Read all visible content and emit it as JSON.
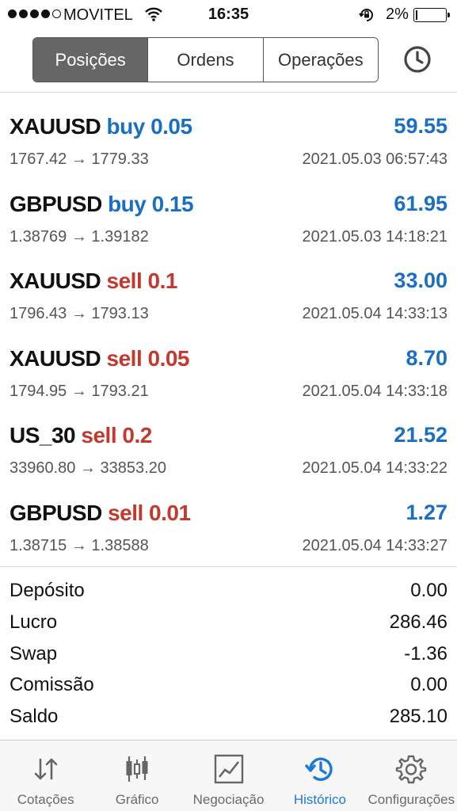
{
  "status_bar": {
    "carrier": "MOVITEL",
    "time": "16:35",
    "battery": "2%"
  },
  "segments": [
    {
      "label": "Posições",
      "active": true
    },
    {
      "label": "Ordens",
      "active": false
    },
    {
      "label": "Operações",
      "active": false
    }
  ],
  "deals": [
    {
      "symbol": "XAUUSD",
      "side": "buy 0.05",
      "direction": "buy",
      "profit": "59.55",
      "prices": "1767.42 → 1779.33",
      "time": "2021.05.03 06:57:43"
    },
    {
      "symbol": "GBPUSD",
      "side": "buy 0.15",
      "direction": "buy",
      "profit": "61.95",
      "prices": "1.38769 → 1.39182",
      "time": "2021.05.03 14:18:21"
    },
    {
      "symbol": "XAUUSD",
      "side": "sell 0.1",
      "direction": "sell",
      "profit": "33.00",
      "prices": "1796.43 → 1793.13",
      "time": "2021.05.04 14:33:13"
    },
    {
      "symbol": "XAUUSD",
      "side": "sell 0.05",
      "direction": "sell",
      "profit": "8.70",
      "prices": "1794.95 → 1793.21",
      "time": "2021.05.04 14:33:18"
    },
    {
      "symbol": "US_30",
      "side": "sell 0.2",
      "direction": "sell",
      "profit": "21.52",
      "prices": "33960.80 → 33853.20",
      "time": "2021.05.04 14:33:22"
    },
    {
      "symbol": "GBPUSD",
      "side": "sell 0.01",
      "direction": "sell",
      "profit": "1.27",
      "prices": "1.38715 → 1.38588",
      "time": "2021.05.04 14:33:27"
    }
  ],
  "summary": [
    {
      "label": "Depósito",
      "value": "0.00"
    },
    {
      "label": "Lucro",
      "value": "286.46"
    },
    {
      "label": "Swap",
      "value": "-1.36"
    },
    {
      "label": "Comissão",
      "value": "0.00"
    },
    {
      "label": "Saldo",
      "value": "285.10"
    }
  ],
  "tabs": [
    {
      "label": "Cotações",
      "icon": "quotes-arrows-icon",
      "active": false
    },
    {
      "label": "Gráfico",
      "icon": "candlestick-chart-icon",
      "active": false
    },
    {
      "label": "Negociação",
      "icon": "trade-chart-icon",
      "active": false
    },
    {
      "label": "Histórico",
      "icon": "history-clock-icon",
      "active": true
    },
    {
      "label": "Configurações",
      "icon": "gear-icon",
      "active": false
    }
  ],
  "colors": {
    "accent": "#1a7ad9",
    "profit": "#1a6fc2",
    "buy": "#1a6fc2",
    "sell": "#c3392e",
    "segment_active": "#666666"
  }
}
